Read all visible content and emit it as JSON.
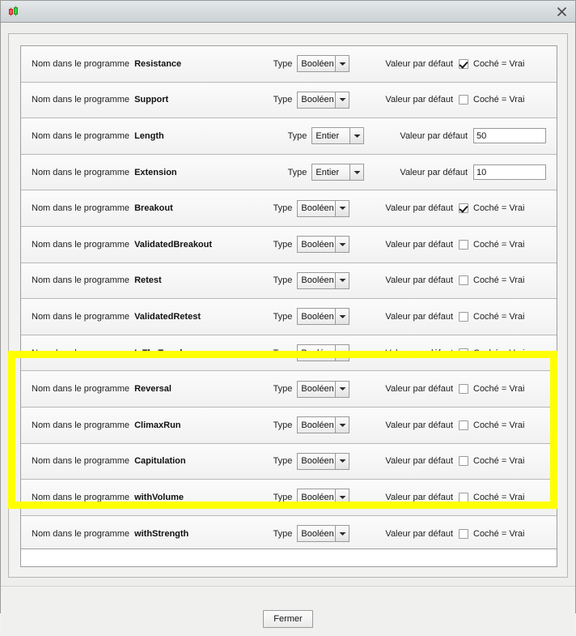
{
  "window": {
    "icon_name": "candlestick-chart-icon",
    "title": "",
    "close_label": "✕"
  },
  "labels": {
    "program_name": "Nom dans le programme",
    "type": "Type",
    "default_value": "Valeur par défaut",
    "checked_true": "Coché = Vrai"
  },
  "types": {
    "boolean": "Booléen",
    "integer": "Entier"
  },
  "highlight": {
    "color": "#ffff00",
    "rows": [
      "InTheTrend",
      "Reversal",
      "ClimaxRun",
      "Capitulation"
    ]
  },
  "rows": [
    {
      "name": "Resistance",
      "type": "Booléen",
      "kind": "bool",
      "checked": true,
      "value": ""
    },
    {
      "name": "Support",
      "type": "Booléen",
      "kind": "bool",
      "checked": false,
      "value": ""
    },
    {
      "name": "Length",
      "type": "Entier",
      "kind": "int",
      "checked": false,
      "value": "50"
    },
    {
      "name": "Extension",
      "type": "Entier",
      "kind": "int",
      "checked": false,
      "value": "10"
    },
    {
      "name": "Breakout",
      "type": "Booléen",
      "kind": "bool",
      "checked": true,
      "value": ""
    },
    {
      "name": "ValidatedBreakout",
      "type": "Booléen",
      "kind": "bool",
      "checked": false,
      "value": ""
    },
    {
      "name": "Retest",
      "type": "Booléen",
      "kind": "bool",
      "checked": false,
      "value": ""
    },
    {
      "name": "ValidatedRetest",
      "type": "Booléen",
      "kind": "bool",
      "checked": false,
      "value": ""
    },
    {
      "name": "InTheTrend",
      "type": "Booléen",
      "kind": "bool",
      "checked": true,
      "value": ""
    },
    {
      "name": "Reversal",
      "type": "Booléen",
      "kind": "bool",
      "checked": false,
      "value": ""
    },
    {
      "name": "ClimaxRun",
      "type": "Booléen",
      "kind": "bool",
      "checked": false,
      "value": ""
    },
    {
      "name": "Capitulation",
      "type": "Booléen",
      "kind": "bool",
      "checked": false,
      "value": ""
    },
    {
      "name": "withVolume",
      "type": "Booléen",
      "kind": "bool",
      "checked": false,
      "value": ""
    },
    {
      "name": "withStrength",
      "type": "Booléen",
      "kind": "bool",
      "checked": false,
      "value": ""
    }
  ],
  "footer": {
    "close_button_label": "Fermer"
  }
}
